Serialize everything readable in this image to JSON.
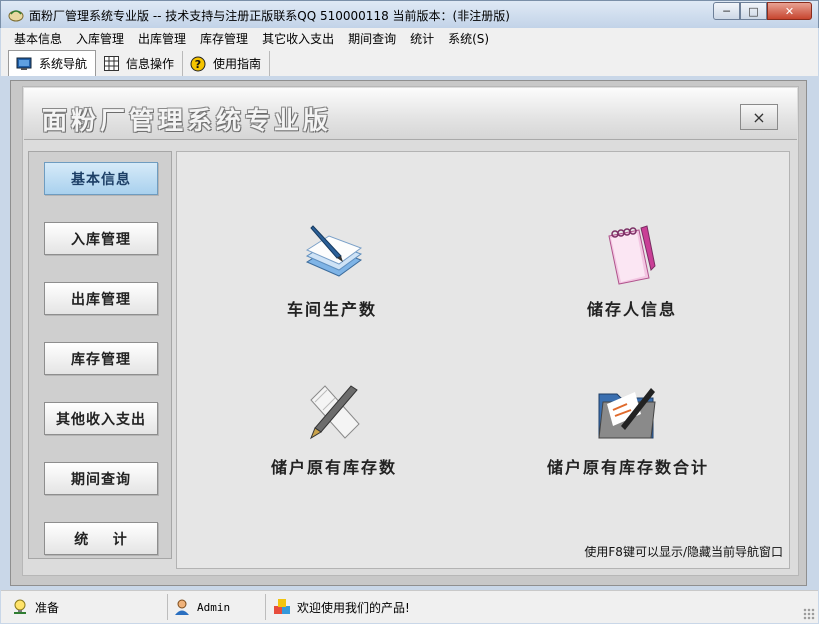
{
  "window": {
    "title": "面粉厂管理系统专业版 -- 技术支持与注册正版联系QQ 510000118    当前版本：(非注册版)",
    "minimize_glyph": "─",
    "maximize_glyph": "□",
    "close_glyph": "✕"
  },
  "menu": [
    "基本信息",
    "入库管理",
    "出库管理",
    "库存管理",
    "其它收入支出",
    "期间查询",
    "统计",
    "系统(S)"
  ],
  "toolbar": {
    "tabs": [
      {
        "label": "系统导航",
        "icon": "monitor-icon"
      },
      {
        "label": "信息操作",
        "icon": "grid-icon"
      },
      {
        "label": "使用指南",
        "icon": "help-icon"
      }
    ]
  },
  "panel": {
    "title": "面粉厂管理系统专业版",
    "close_glyph": "×"
  },
  "nav": {
    "buttons": [
      "基本信息",
      "入库管理",
      "出库管理",
      "库存管理",
      "其他收入支出",
      "期间查询",
      "统    计"
    ],
    "active_index": 0
  },
  "content": {
    "tiles": [
      {
        "label": "车间生产数",
        "icon": "notepad-pen-icon"
      },
      {
        "label": "储存人信息",
        "icon": "notebook-icon"
      },
      {
        "label": "储户原有库存数",
        "icon": "pen-scroll-icon"
      },
      {
        "label": "储户原有库存数合计",
        "icon": "folder-wand-icon"
      }
    ],
    "hint": "使用F8键可以显示/隐藏当前导航窗口"
  },
  "statusbar": {
    "ready": "准备",
    "user": "Admin",
    "welcome": "欢迎使用我们的产品!"
  },
  "colors": {
    "accent": "#a9d1ee",
    "panel_bg": "#dcdcdc"
  }
}
